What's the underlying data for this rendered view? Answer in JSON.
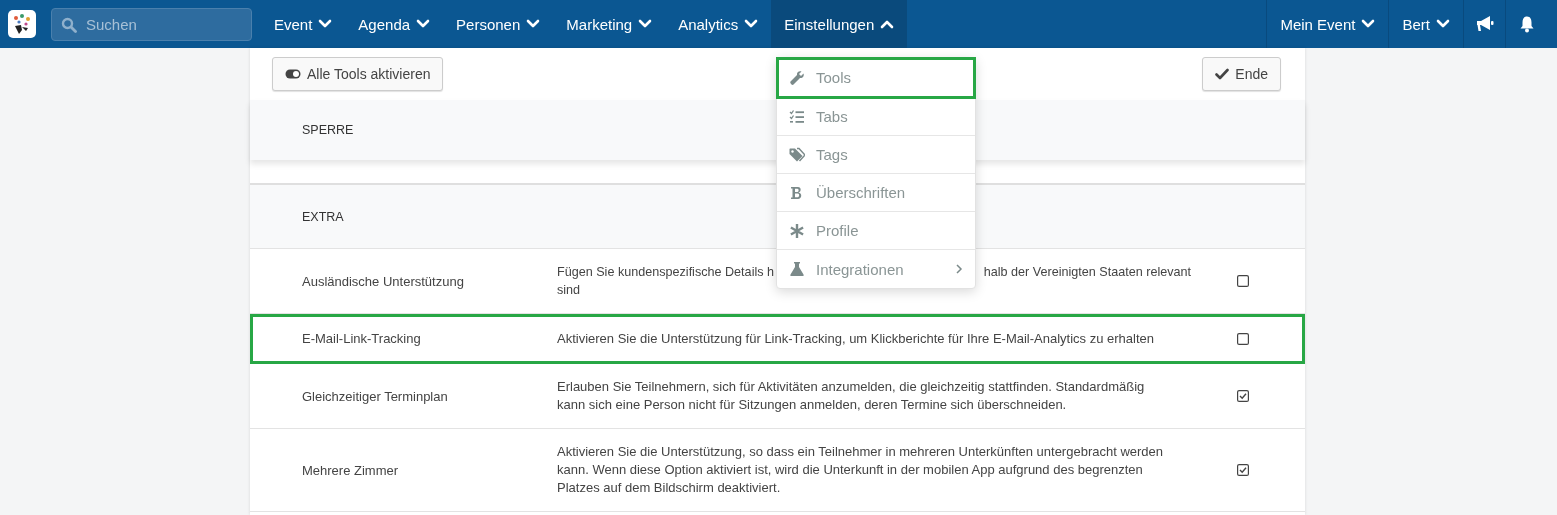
{
  "topbar": {
    "search": {
      "placeholder": "Suchen"
    },
    "menus": [
      {
        "label": "Event",
        "expanded": false
      },
      {
        "label": "Agenda",
        "expanded": false
      },
      {
        "label": "Personen",
        "expanded": false
      },
      {
        "label": "Marketing",
        "expanded": false
      },
      {
        "label": "Analytics",
        "expanded": false
      },
      {
        "label": "Einstellungen",
        "expanded": true
      }
    ],
    "right_menus": [
      {
        "label": "Mein Event",
        "expanded": false
      },
      {
        "label": "Bert",
        "expanded": false
      }
    ]
  },
  "toolbar": {
    "toggle_button": "Alle Tools aktivieren",
    "done_button": "Ende"
  },
  "dropdown": [
    {
      "label": "Tools",
      "kind": "wrench",
      "highlighted": true,
      "submenu": false
    },
    {
      "label": "Tabs",
      "kind": "checklist",
      "highlighted": false,
      "submenu": false
    },
    {
      "label": "Tags",
      "kind": "tags",
      "highlighted": false,
      "submenu": false
    },
    {
      "label": "Überschriften",
      "kind": "bold",
      "highlighted": false,
      "submenu": false
    },
    {
      "label": "Profile",
      "kind": "asterisk",
      "highlighted": false,
      "submenu": false
    },
    {
      "label": "Integrationen",
      "kind": "flask",
      "highlighted": false,
      "submenu": true
    }
  ],
  "sections": [
    {
      "title": "SPERRE"
    },
    {
      "title": "EXTRA",
      "rows": [
        {
          "name": "Ausländische Unterstützung",
          "description_fragments": [
            [
              "Fügen Sie kundenspezifische Details h",
              "halb der Vereinigten Staaten relevant"
            ],
            [
              "sind"
            ]
          ],
          "checked": false,
          "highlighted": false
        },
        {
          "name": "E-Mail-Link-Tracking",
          "description": "Aktivieren Sie die Unterstützung für Link-Tracking, um Klickberichte für Ihre E-Mail-Analytics zu erhalten",
          "checked": false,
          "highlighted": true
        },
        {
          "name": "Gleichzeitiger Terminplan",
          "description": "Erlauben Sie Teilnehmern, sich für Aktivitäten anzumelden, die gleichzeitig stattfinden. Standardmäßig kann sich eine Person nicht für Sitzungen anmelden, deren Termine sich überschneiden.",
          "checked": true,
          "highlighted": false
        },
        {
          "name": "Mehrere Zimmer",
          "description": "Aktivieren Sie die Unterstützung, so dass ein Teilnehmer in mehreren Unterkünften untergebracht werden kann. Wenn diese Option aktiviert ist, wird die Unterkunft in der mobilen App aufgrund des begrenzten Platzes auf dem Bildschirm deaktiviert.",
          "checked": true,
          "highlighted": false
        }
      ]
    }
  ]
}
